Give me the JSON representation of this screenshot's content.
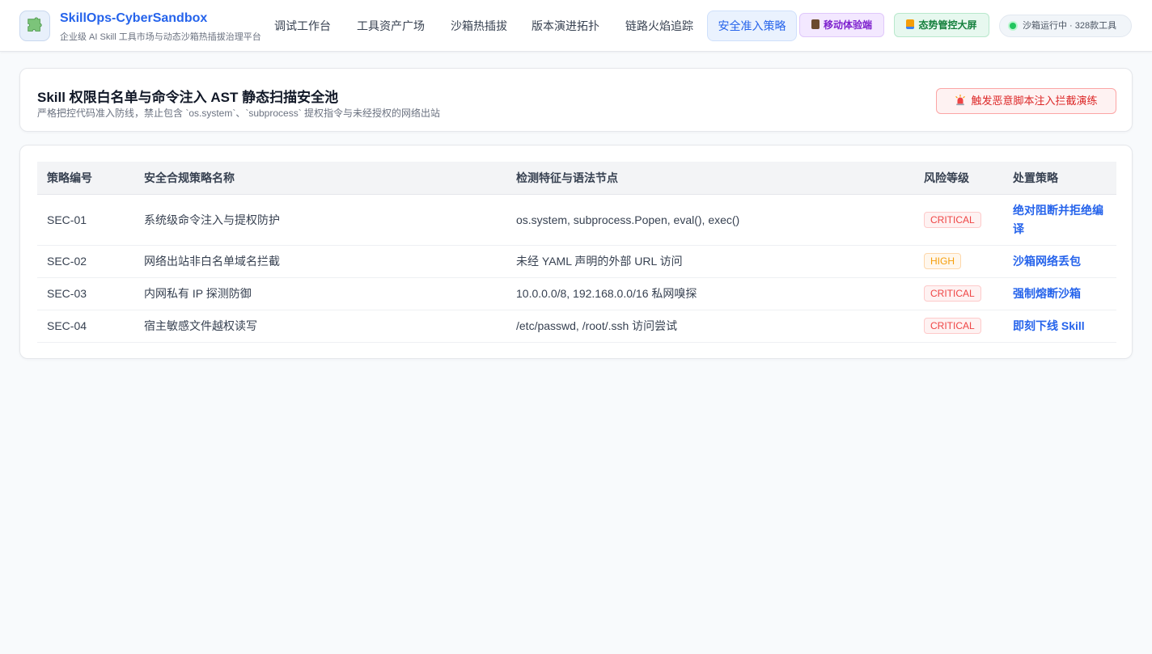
{
  "header": {
    "brand_title": "SkillOps-CyberSandbox",
    "brand_subtitle": "企业级 AI Skill 工具市场与动态沙箱热插拔治理平台",
    "nav": [
      {
        "label": "调试工作台"
      },
      {
        "label": "工具资产广场"
      },
      {
        "label": "沙箱热插拔"
      },
      {
        "label": "版本演进拓扑"
      },
      {
        "label": "链路火焰追踪"
      },
      {
        "label": "安全准入策略",
        "active": true
      }
    ],
    "mobile_button": "移动体验端",
    "screen_button": "态势管控大屏",
    "status_text": "沙箱运行中 · 328款工具",
    "colors": {
      "accent": "#2563eb",
      "status_ok": "#22c55e"
    }
  },
  "section": {
    "title": "Skill 权限白名单与命令注入 AST 静态扫描安全池",
    "subtitle": "严格把控代码准入防线，禁止包含 `os.system`、`subprocess` 提权指令与未经授权的网络出站",
    "alert_button": "触发恶意脚本注入拦截演练",
    "alert_icon": "siren-icon"
  },
  "table": {
    "headers": [
      "策略编号",
      "安全合规策略名称",
      "检测特征与语法节点",
      "风险等级",
      "处置策略"
    ],
    "rows": [
      {
        "id": "SEC-01",
        "name": "系统级命令注入与提权防护",
        "feature": "os.system, subprocess.Popen, eval(), exec()",
        "risk": "CRITICAL",
        "action": "绝对阻断并拒绝编译"
      },
      {
        "id": "SEC-02",
        "name": "网络出站非白名单域名拦截",
        "feature": "未经 YAML 声明的外部 URL 访问",
        "risk": "HIGH",
        "action": "沙箱网络丢包"
      },
      {
        "id": "SEC-03",
        "name": "内网私有 IP 探测防御",
        "feature": "10.0.0.0/8, 192.168.0.0/16 私网嗅探",
        "risk": "CRITICAL",
        "action": "强制熔断沙箱"
      },
      {
        "id": "SEC-04",
        "name": "宿主敏感文件越权读写",
        "feature": "/etc/passwd, /root/.ssh 访问尝试",
        "risk": "CRITICAL",
        "action": "即刻下线 Skill"
      }
    ]
  }
}
